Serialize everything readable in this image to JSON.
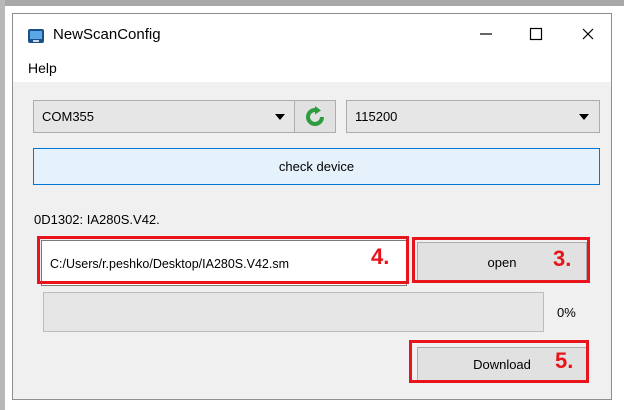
{
  "window": {
    "title": "NewScanConfig"
  },
  "menu": {
    "items": [
      "Help"
    ]
  },
  "port": {
    "selected": "COM355"
  },
  "baud": {
    "selected": "115200"
  },
  "buttons": {
    "check_device": "check device",
    "open": "open",
    "download": "Download"
  },
  "device_info": "0D1302: IA280S.V42.",
  "file_path": "C:/Users/r.peshko/Desktop/IA280S.V42.sm",
  "progress": {
    "value": 0,
    "label": "0%"
  },
  "callouts": {
    "path": "4.",
    "open": "3.",
    "download": "5."
  },
  "colors": {
    "callout": "#e8141b",
    "refresh_icon": "#2e9b3e"
  }
}
